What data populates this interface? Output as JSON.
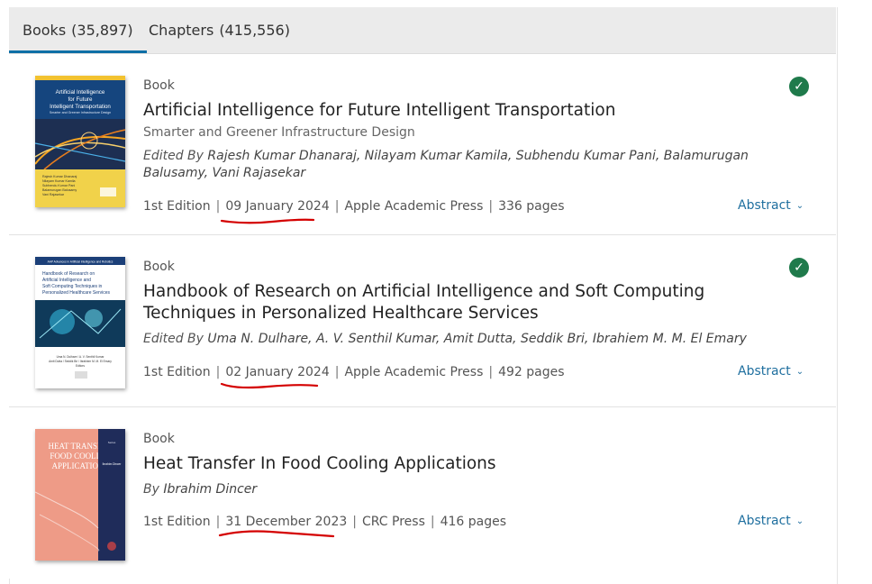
{
  "tabs": [
    {
      "label": "Books",
      "count": "(35,897)"
    },
    {
      "label": "Chapters",
      "count": "(415,556)"
    }
  ],
  "results": [
    {
      "type": "Book",
      "title": "Artificial Intelligence for Future Intelligent Transportation",
      "subtitle": "Smarter and Greener Infrastructure Design",
      "authors_prefix": "Edited By",
      "authors": "Rajesh Kumar Dhanaraj, Nilayam Kumar Kamila, Subhendu Kumar Pani, Balamurugan Balusamy, Vani Rajasekar",
      "edition": "1st Edition",
      "date": "09 January 2024",
      "publisher": "Apple Academic Press",
      "pages": "336 pages",
      "abstract_label": "Abstract",
      "cover_text": {
        "title": "Artificial Intelligence for Future Intelligent Transportation",
        "subtitle": "Smarter and Greener Infrastructure Design",
        "editors": "Rajesh Kumar Dhanaraj / Nilayam Kumar Kamila / Subhendu Kumar Pani / Balamurugan Balusamy / Vani Rajasekar / Editors"
      }
    },
    {
      "type": "Book",
      "title": "Handbook of Research on Artificial Intelligence and Soft Computing Techniques in Personalized Healthcare Services",
      "subtitle": "",
      "authors_prefix": "Edited By",
      "authors": "Uma N. Dulhare, A. V. Senthil Kumar, Amit Dutta, Seddik Bri, Ibrahiem M. M. El Emary",
      "edition": "1st Edition",
      "date": "02 January 2024",
      "publisher": "Apple Academic Press",
      "pages": "492 pages",
      "abstract_label": "Abstract",
      "cover_text": {
        "series": "AAP Advances in Artificial Intelligence and Robotics",
        "title": "Handbook of Research on Artificial Intelligence and Soft Computing Techniques in Personalized Healthcare Services",
        "editors": "Uma N. Dulhare / A. V. Senthil Kumar / Amit Dutta / Seddik Bri / Ibrahiem M. M. El Emary / Editors"
      }
    },
    {
      "type": "Book",
      "title": "Heat Transfer In Food Cooling Applications",
      "subtitle": "",
      "authors_prefix": "By",
      "authors": "Ibrahim Dincer",
      "edition": "1st Edition",
      "date": "31 December 2023",
      "publisher": "CRC Press",
      "pages": "416 pages",
      "abstract_label": "Abstract",
      "cover_text": {
        "title": "HEAT TRANSFER IN FOOD COOLING APPLICATIONS",
        "author": "Ibrahim Dincer"
      }
    }
  ],
  "colors": {
    "accent": "#0e6fa6",
    "check": "#1f7a4b",
    "annotation": "#d40000",
    "link": "#1f6f9f"
  },
  "icons": [
    "check-circle-icon",
    "chevron-down-icon"
  ]
}
